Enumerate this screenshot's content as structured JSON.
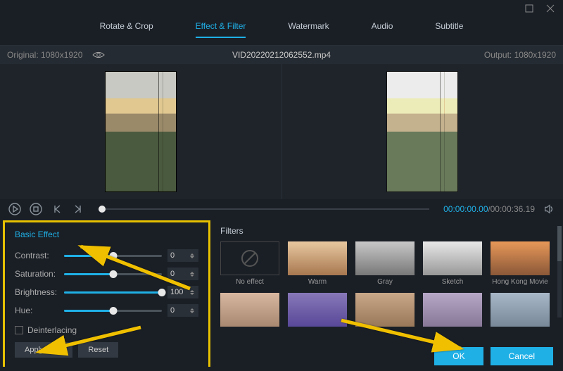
{
  "window": {
    "maximize": "maximize",
    "close": "close"
  },
  "tabs": [
    "Rotate & Crop",
    "Effect & Filter",
    "Watermark",
    "Audio",
    "Subtitle"
  ],
  "active_tab": 1,
  "file": {
    "original": "Original: 1080x1920",
    "name": "VID20220212062552.mp4",
    "output": "Output: 1080x1920"
  },
  "time": {
    "current": "00:00:00.00",
    "total": "00:00:36.19"
  },
  "basic": {
    "title": "Basic Effect",
    "sliders": [
      {
        "label": "Contrast:",
        "value": 0,
        "pos": 50
      },
      {
        "label": "Saturation:",
        "value": 0,
        "pos": 50
      },
      {
        "label": "Brightness:",
        "value": 100,
        "pos": 100
      },
      {
        "label": "Hue:",
        "value": 0,
        "pos": 50
      }
    ],
    "deinterlacing": "Deinterlacing",
    "apply_all": "Apply to All",
    "reset": "Reset"
  },
  "filters": {
    "title": "Filters",
    "row1": [
      {
        "label": "No effect",
        "cls": "noeffect"
      },
      {
        "label": "Warm",
        "cls": "warm"
      },
      {
        "label": "Gray",
        "cls": "gray"
      },
      {
        "label": "Sketch",
        "cls": "sketch"
      },
      {
        "label": "Hong Kong Movie",
        "cls": "hk"
      }
    ],
    "row2": [
      {
        "label": "",
        "cls": "f2a"
      },
      {
        "label": "",
        "cls": "f2b"
      },
      {
        "label": "",
        "cls": "f2c"
      },
      {
        "label": "",
        "cls": "f2d"
      },
      {
        "label": "",
        "cls": "f2e"
      }
    ]
  },
  "footer": {
    "ok": "OK",
    "cancel": "Cancel"
  }
}
